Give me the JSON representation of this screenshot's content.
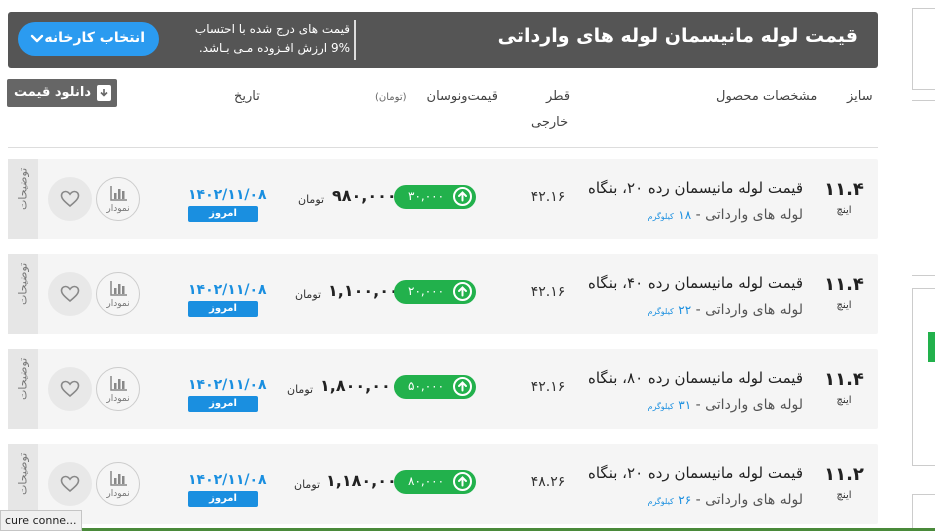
{
  "header": {
    "title": "قیمت لوله مانیسمان لوله های وارداتی",
    "note_line1": "قیمت های درج شده با احتساب",
    "note_line2": "9% ارزش افـزوده مـی بـاشد.",
    "select_factory_label": "انتخاب کارخانه"
  },
  "columns": {
    "size": "سایز",
    "product_spec": "مشخصات محصول",
    "outer_dia_1": "قطر",
    "outer_dia_2": "خارجی",
    "price_change": "قیمت‌ونوسان",
    "price_unit": "(تومان)",
    "date": "تاریخ",
    "download_label": "دانلود قیمت"
  },
  "rows": [
    {
      "size": "۱۱.۴",
      "size_unit": "اینچ",
      "name": "قیمت لوله مانیسمان رده ۲۰، بنگاه",
      "sub": "لوله های وارداتی - ",
      "weight": "۱۸",
      "weight_unit": "کیلوگرم",
      "diameter": "۴۲.۱۶",
      "change": "۳۰,۰۰۰",
      "price": "۹۸۰,۰۰۰",
      "currency": "تومان",
      "date": "۱۴۰۲/۱۱/۰۸",
      "today": "امروز",
      "chart_label": "نمودار",
      "desc_label": "توضیحات"
    },
    {
      "size": "۱۱.۴",
      "size_unit": "اینچ",
      "name": "قیمت لوله مانیسمان رده ۴۰، بنگاه",
      "sub": "لوله های وارداتی - ",
      "weight": "۲۲",
      "weight_unit": "کیلوگرم",
      "diameter": "۴۲.۱۶",
      "change": "۲۰,۰۰۰",
      "price": "۱,۱۰۰,۰۰۰",
      "currency": "تومان",
      "date": "۱۴۰۲/۱۱/۰۸",
      "today": "امروز",
      "chart_label": "نمودار",
      "desc_label": "توضیحات"
    },
    {
      "size": "۱۱.۴",
      "size_unit": "اینچ",
      "name": "قیمت لوله مانیسمان رده ۸۰، بنگاه",
      "sub": "لوله های وارداتی - ",
      "weight": "۳۱",
      "weight_unit": "کیلوگرم",
      "diameter": "۴۲.۱۶",
      "change": "۵۰,۰۰۰",
      "price": "۱,۸۰۰,۰۰۰",
      "currency": "تومان",
      "date": "۱۴۰۲/۱۱/۰۸",
      "today": "امروز",
      "chart_label": "نمودار",
      "desc_label": "توضیحات"
    },
    {
      "size": "۱۱.۲",
      "size_unit": "اینچ",
      "name": "قیمت لوله مانیسمان رده ۲۰، بنگاه",
      "sub": "لوله های وارداتی - ",
      "weight": "۲۶",
      "weight_unit": "کیلوگرم",
      "diameter": "۴۸.۲۶",
      "change": "۸۰,۰۰۰",
      "price": "۱,۱۸۰,۰۰۰",
      "currency": "تومان",
      "date": "۱۴۰۲/۱۱/۰۸",
      "today": "امروز",
      "chart_label": "نمودار",
      "desc_label": "توضیحات"
    }
  ],
  "status_bar": "cure conne...",
  "colors": {
    "header_bg": "#555555",
    "accent_blue": "#2b9bf0",
    "up_green": "#22b14c",
    "date_blue": "#1a8fe0"
  }
}
